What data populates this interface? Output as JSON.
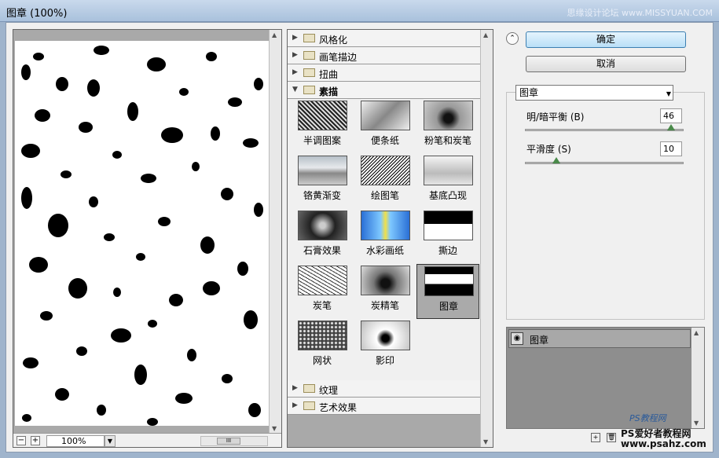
{
  "window": {
    "title": "图章 (100%)",
    "watermark": "思缘设计论坛 www.MISSYUAN.COM"
  },
  "preview": {
    "zoom": "100%",
    "zoom_out": "−",
    "zoom_in": "+"
  },
  "gallery": {
    "categories_top": [
      {
        "label": "风格化",
        "open": false
      },
      {
        "label": "画笔描边",
        "open": false
      },
      {
        "label": "扭曲",
        "open": false
      },
      {
        "label": "素描",
        "open": true
      }
    ],
    "tiles": [
      {
        "name": "半调图案"
      },
      {
        "name": "便条纸"
      },
      {
        "name": "粉笔和炭笔"
      },
      {
        "name": "铬黄渐变"
      },
      {
        "name": "绘图笔"
      },
      {
        "name": "基底凸现"
      },
      {
        "name": "石膏效果"
      },
      {
        "name": "水彩画纸"
      },
      {
        "name": "撕边"
      },
      {
        "name": "炭笔"
      },
      {
        "name": "炭精笔"
      },
      {
        "name": "图章",
        "selected": true
      },
      {
        "name": "网状"
      },
      {
        "name": "影印"
      }
    ],
    "categories_bottom": [
      {
        "label": "纹理"
      },
      {
        "label": "艺术效果"
      }
    ]
  },
  "buttons": {
    "ok": "确定",
    "cancel": "取消"
  },
  "filter_select": "图章",
  "params": {
    "balance_label": "明/暗平衡 (B)",
    "balance_value": "46",
    "balance_fraction": 0.92,
    "smooth_label": "平滑度 (S)",
    "smooth_value": "10",
    "smooth_fraction": 0.2
  },
  "layers": {
    "item": "图章"
  },
  "footer": {
    "stamp_text": "PS教程网",
    "site_line1": "PS爱好者教程网",
    "site_line2": "www.psahz.com"
  }
}
